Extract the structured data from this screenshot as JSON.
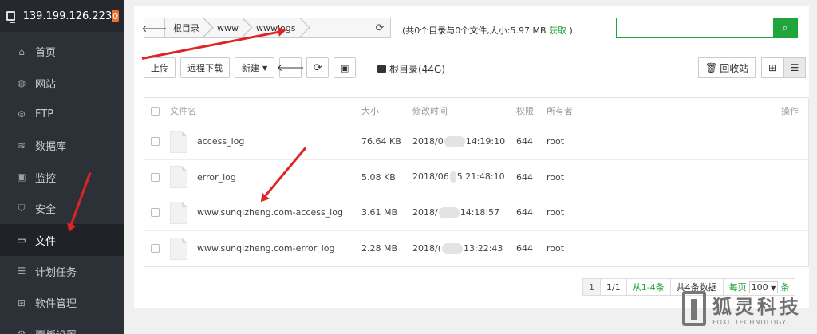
{
  "sidebar": {
    "server_ip": "139.199.126.223",
    "badge_count": "0",
    "items": [
      {
        "label": "首页",
        "icon": "home-icon"
      },
      {
        "label": "网站",
        "icon": "globe-icon"
      },
      {
        "label": "FTP",
        "icon": "ftp-icon"
      },
      {
        "label": "数据库",
        "icon": "database-icon"
      },
      {
        "label": "监控",
        "icon": "monitor-icon"
      },
      {
        "label": "安全",
        "icon": "shield-icon"
      },
      {
        "label": "文件",
        "icon": "folder-icon",
        "active": true
      },
      {
        "label": "计划任务",
        "icon": "list-icon"
      },
      {
        "label": "软件管理",
        "icon": "grid-icon"
      },
      {
        "label": "面板设置",
        "icon": "gear-icon"
      }
    ]
  },
  "path": {
    "crumbs": [
      "根目录",
      "www",
      "wwwlogs"
    ]
  },
  "dir_info": {
    "text": "(共0个目录与0个文件,大小:5.97 MB",
    "link": "获取",
    "close": ")"
  },
  "search": {
    "placeholder": "",
    "value": ""
  },
  "toolbar": {
    "upload": "上传",
    "remote_download": "远程下载",
    "new": "新建",
    "disk": "根目录(44G)",
    "recycle": "回收站"
  },
  "table": {
    "headers": {
      "name": "文件名",
      "size": "大小",
      "mtime": "修改时间",
      "perm": "权限",
      "owner": "所有者",
      "ops": "操作"
    },
    "rows": [
      {
        "name": "access_log",
        "size": "76.64 KB",
        "time_a": "2018/0",
        "time_b": "14:19:10",
        "perm": "644",
        "owner": "root"
      },
      {
        "name": "error_log",
        "size": "5.08 KB",
        "time_a": "2018/06",
        "time_b": "5 21:48:10",
        "perm": "644",
        "owner": "root"
      },
      {
        "name": "www.sunqizheng.com-access_log",
        "size": "3.61 MB",
        "time_a": "2018/",
        "time_b": "14:18:57",
        "perm": "644",
        "owner": "root"
      },
      {
        "name": "www.sunqizheng.com-error_log",
        "size": "2.28 MB",
        "time_a": "2018/(",
        "time_b": "13:22:43",
        "perm": "644",
        "owner": "root"
      }
    ]
  },
  "pager": {
    "current": "1",
    "pages": "1/1",
    "range": "从1-4条",
    "total": "共4条数据",
    "per_page_label": "每页",
    "per_page_value": "100",
    "per_page_unit": "条"
  },
  "watermark": {
    "cn": "狐灵科技",
    "en": "FOXL TECHNOLOGY"
  },
  "colors": {
    "accent_green": "#20a53a",
    "sidebar_bg": "#2c3138",
    "annotation_red": "#e02424",
    "badge_orange": "#e8732c"
  }
}
